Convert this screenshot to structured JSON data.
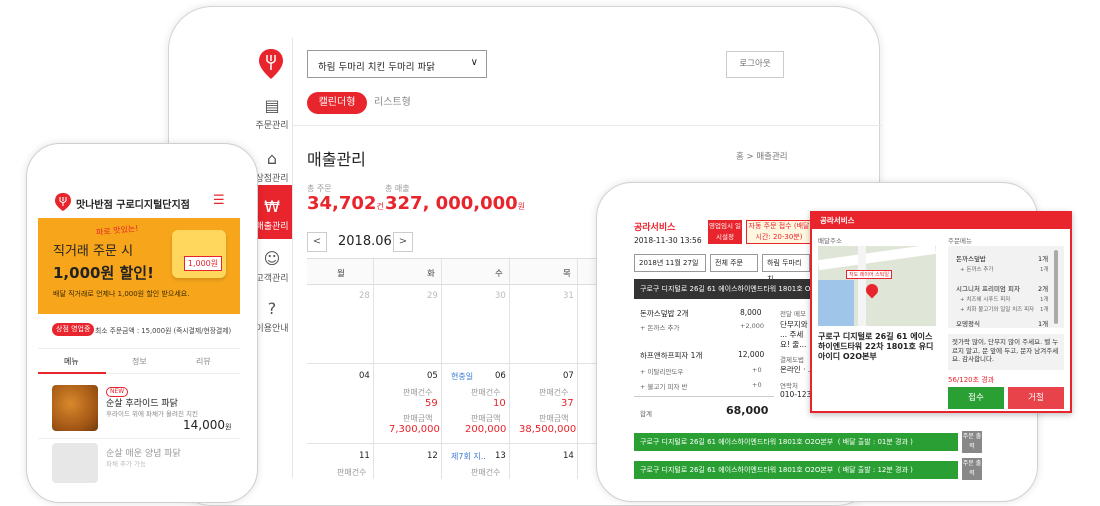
{
  "tablet": {
    "store_select": "하림 두마리 치킨 두마리 파닭",
    "logout": "로그아웃",
    "view_calendar": "캘린더형",
    "view_list": "리스트형",
    "sidebar": [
      {
        "label": "주문관리",
        "icon": "receipt-icon"
      },
      {
        "label": "상점관리",
        "icon": "store-icon"
      },
      {
        "label": "매출관리",
        "icon": "won-icon"
      },
      {
        "label": "고객관리",
        "icon": "smile-icon"
      },
      {
        "label": "이용안내",
        "icon": "help-icon"
      }
    ],
    "page_title": "매출관리",
    "breadcrumb": "홈 > 매출관리",
    "total_orders_label": "총 주문",
    "total_orders_value": "34,702",
    "total_orders_unit": "건",
    "total_sales_label": "총 매출",
    "total_sales_value": "327, 000,000",
    "total_sales_unit": "원",
    "month": "2018.06",
    "prev": "<",
    "next": ">",
    "weekdays": [
      "월",
      "화",
      "수",
      "목"
    ],
    "days_row1": [
      "28",
      "29",
      "30",
      "31"
    ],
    "days_row2": [
      "04",
      "05",
      "06",
      "07"
    ],
    "days_row3": [
      "11",
      "12",
      "13",
      "14"
    ],
    "holiday1": "현충일",
    "holiday2": "제7회 지..",
    "count_label": "판매건수",
    "amount_label": "판매금액",
    "d05_count": "59",
    "d05_amount": "7,300,000",
    "d06_count": "10",
    "d06_amount": "200,000",
    "d07_count": "37",
    "d07_amount": "38,500,000"
  },
  "phone": {
    "store_name": "맛나반점 구로디지털단지점",
    "banner_small": "파로 맛있는!",
    "banner_line1": "직거래 주문 시",
    "banner_line2": "1,000원 할인!",
    "banner_sub": "배달 직거래로 언제나 1,000원 할인 받으세요.",
    "coupon": "1,000원",
    "badge": "상점 영업중",
    "min_order": "최소 주문금액 : 15,000원 (즉시결제/현장결제)",
    "tabs": [
      "메뉴",
      "정보",
      "리뷰"
    ],
    "new_tag": "NEW",
    "item1_name": "순살 후라이드 파닭",
    "item1_desc": "후라이드 위에 파채가 올려진 치킨",
    "item1_price": "14,000",
    "item1_unit": "원",
    "item2_name": "순살 매운 양념 파닭",
    "item2_desc": "파채 추가 가능"
  },
  "tablet2": {
    "logo": "공라서비스",
    "datetime": "2018-11-30 13:56",
    "pause_btn": "영업임시 일시설정",
    "auto_btn": "자동 주문 접수 (배달시간: 20-30분)",
    "date_select": "2018년 11월 27일",
    "order_select": "전체 주문",
    "branch_select": "하림 두마리 치",
    "address_bar": "구로구 디지털로 26길 61 에이스하이엔드타워 1801호 O2",
    "items": [
      {
        "name": "돈까스덮밥 2개",
        "price": "8,000",
        "sub": "+ 돈까스 추가",
        "sub_price": "+2,000"
      },
      {
        "name": "하프앤하프피자 1개",
        "price": "12,000",
        "sub": "+ 이탈리안도우",
        "sub_price": "+0"
      },
      {
        "name": "",
        "price": "",
        "sub": "+ 불고기 피자 반",
        "sub_price": "+0"
      }
    ],
    "total_label": "합계",
    "total": "68,000",
    "memo_label": "전달 메모",
    "memo_text": "단무지와 ... 주세요! 줄... 줄겠습니...",
    "pay_label": "결제도법",
    "pay_value": "온라인 · ...",
    "contact_label": "연락처",
    "contact": "010-123...",
    "green_bars": [
      {
        "text": "구로구 디지털로 26길 61 에이스하이엔드타워 1801호 O2O본부",
        "tail": "( 배달 출발 : 01분 경과 )",
        "tag": "주문 출력"
      },
      {
        "text": "구로구 디지털로 26길 61 에이스하이엔드타워 1801호 O2O본부",
        "tail": "( 배달 출발 : 12분 경과 )",
        "tag": "주문 출력"
      }
    ]
  },
  "popup": {
    "title": "공라서비스",
    "addr_label": "배달주소",
    "menu_label": "주문메뉴",
    "map_label": "지도 레이어 스틱일",
    "address": "구로구 디지털로 26길 61 에이스하이엔드타워 22차 1801호 유디아이디 O2O본부",
    "menu": [
      {
        "name": "돈까스덮밥",
        "qty": "1개",
        "sub": "+ 돈까스 추가",
        "sub_qty": "1개"
      },
      {
        "name": "시그니처 프리미엄 피자",
        "qty": "2개",
        "sub": "+ 치즈에 시푸드 피자",
        "sub_qty": "1개"
      },
      {
        "name": "",
        "qty": "",
        "sub": "+ 치화 불고기와 일일 치즈 피자",
        "sub_qty": "1개"
      },
      {
        "name": "오뎅정식",
        "qty": "1개",
        "sub": "",
        "sub_qty": ""
      }
    ],
    "memo": "젓가락 많이, 단무지 많이 주세요. 벨 누르지 말고, 문 앞에 두고, 문자 남겨주세요. 감사합니다.",
    "count": "56/120초 경과",
    "accept": "접수",
    "reject": "거절"
  },
  "colors": {
    "accent": "#e8242c",
    "green": "#2aa034",
    "banner": "#f7a61b"
  }
}
